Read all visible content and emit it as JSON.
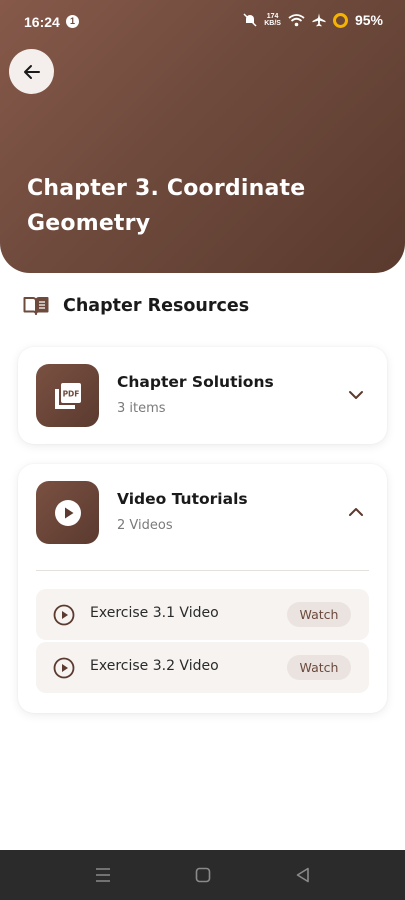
{
  "status_bar": {
    "time": "16:24",
    "notification_count": "1",
    "net_speed_value": "174",
    "net_speed_unit": "KB/S",
    "battery": "95%"
  },
  "header": {
    "back_icon": "arrow-left-icon",
    "title": "Chapter 3. Coordinate Geometry"
  },
  "section": {
    "icon": "book-open-icon",
    "title": "Chapter Resources"
  },
  "cards": [
    {
      "icon": "pdf-file-icon",
      "title": "Chapter Solutions",
      "subtitle": "3 items",
      "expanded": false
    },
    {
      "icon": "play-circle-icon",
      "title": "Video Tutorials",
      "subtitle": "2 Videos",
      "expanded": true,
      "items": [
        {
          "label": "Exercise 3.1 Video",
          "action": "Watch"
        },
        {
          "label": "Exercise 3.2 Video",
          "action": "Watch"
        }
      ]
    }
  ],
  "colors": {
    "brand_brown": "#6e4a3c",
    "background": "#ffffff",
    "watch_pill": "#ebe3df",
    "nav_bar": "#2b2b2b"
  },
  "nav": {
    "icons": [
      "menu-icon",
      "home-square-icon",
      "back-triangle-icon"
    ]
  }
}
